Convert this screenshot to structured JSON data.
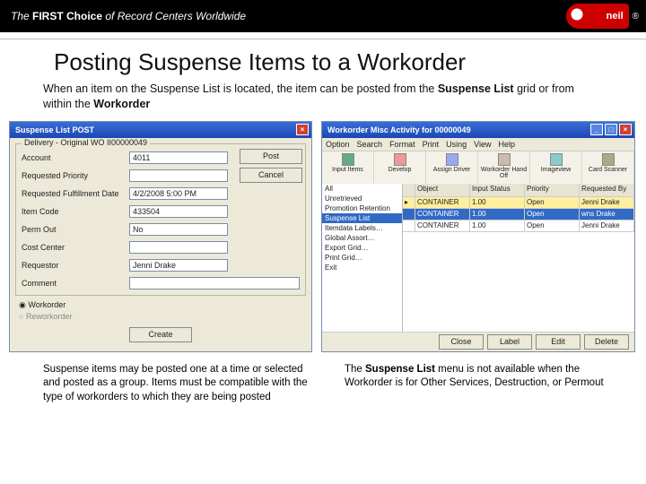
{
  "header": {
    "tagline_pre": "The ",
    "tagline_strong": "FIRST Choice",
    "tagline_post": " of Record Centers Worldwide",
    "logo_text": "neil",
    "logo_mark": "®"
  },
  "title": "Posting Suspense Items to a Workorder",
  "intro": {
    "t1": "When an item on the Suspense List is located, the item can be posted from the ",
    "b1": "Suspense List",
    "t2": " grid or from within the ",
    "b2": "Workorder"
  },
  "left_dialog": {
    "title": "Suspense List POST",
    "group_legend": "Delivery - Original WO II00000049",
    "rows": {
      "account": {
        "label": "Account",
        "value": "4011"
      },
      "priority": {
        "label": "Requested Priority",
        "value": ""
      },
      "date": {
        "label": "Requested Fulfillment Date",
        "value": "4/2/2008 5:00 PM"
      },
      "itemcode": {
        "label": "Item Code",
        "value": "433504"
      },
      "permout": {
        "label": "Perm Out",
        "value": "No"
      },
      "costcenter": {
        "label": "Cost Center",
        "value": ""
      },
      "requestor": {
        "label": "Requestor",
        "value": "Jenni Drake"
      },
      "comment": {
        "label": "Comment",
        "value": ""
      }
    },
    "buttons": {
      "post": "Post",
      "cancel": "Cancel",
      "create": "Create"
    },
    "radios": {
      "workorder": "Workorder",
      "reworkorder": "Reworkorder"
    }
  },
  "right_dialog": {
    "title": "Workorder Misc Activity for 00000049",
    "menu": [
      "Option",
      "Search",
      "Format",
      "Print",
      "Using",
      "View",
      "Help"
    ],
    "toolbar": [
      "Input Items",
      "Develop",
      "Assign Driver",
      "Workorder Hand Off",
      "Imageview",
      "Card Scanner"
    ],
    "sidelist": {
      "items": [
        "All",
        "Unretrieved",
        "Promotion Retention"
      ],
      "sel": "Suspense List",
      "rest": [
        "Itemdata Labels…",
        "Global Assort…",
        "Export Grid…",
        "Print Grid…",
        "Exit"
      ]
    },
    "grid": {
      "headers": [
        "",
        "Object",
        "Input Status",
        "Priority",
        "Requested By"
      ],
      "rows": [
        [
          "",
          "CONTAINER",
          "1.00",
          "Open",
          "Jenni Drake"
        ],
        [
          "",
          "CONTAINER",
          "1.00",
          "Open",
          "wns Drake"
        ],
        [
          "",
          "CONTAINER",
          "1.00",
          "Open",
          "Jenni Drake"
        ]
      ]
    },
    "footer": [
      "Close",
      "Label",
      "Edit",
      "Delete"
    ]
  },
  "bottom": {
    "left": "Suspense items may be posted one at a time or selected and posted as a group. Items must be compatible with the type of workorders to which they are being posted",
    "right_pre": "The ",
    "right_b": "Suspense List",
    "right_post": " menu is not available when the Workorder is for Other Services, Destruction, or Permout"
  }
}
